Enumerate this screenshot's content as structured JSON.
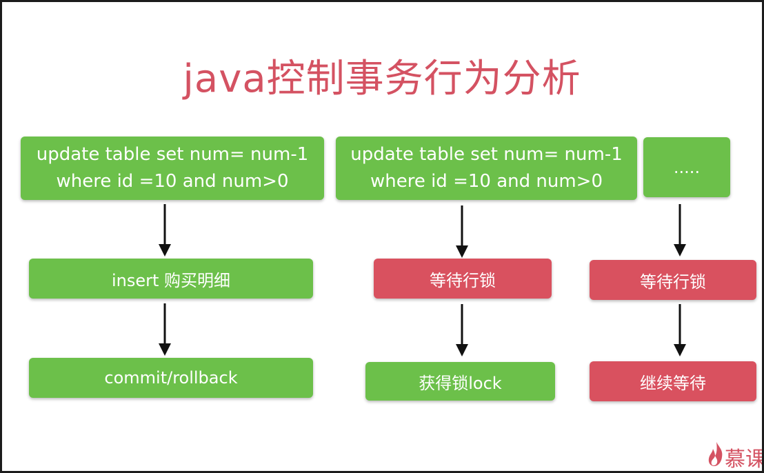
{
  "slide": {
    "title": "java控制事务行为分析"
  },
  "columns": {
    "left": {
      "update_line1": "update table set num= num-1",
      "update_line2": "where id =10 and num>0",
      "step1": "insert 购买明细",
      "step2": "commit/rollback"
    },
    "middle": {
      "update_line1": "update table set num= num-1",
      "update_line2": "where id =10 and num>0",
      "step1": "等待行锁",
      "step2": "获得锁lock"
    },
    "right": {
      "ellipsis": ".....",
      "step1": "等待行锁",
      "step2": "继续等待"
    }
  },
  "colors": {
    "title": "#d45262",
    "success_box": "#6cc04a",
    "wait_box": "#d9515f",
    "arrow": "#111111"
  },
  "logo": {
    "icon": "flame-icon",
    "text": "慕课"
  }
}
